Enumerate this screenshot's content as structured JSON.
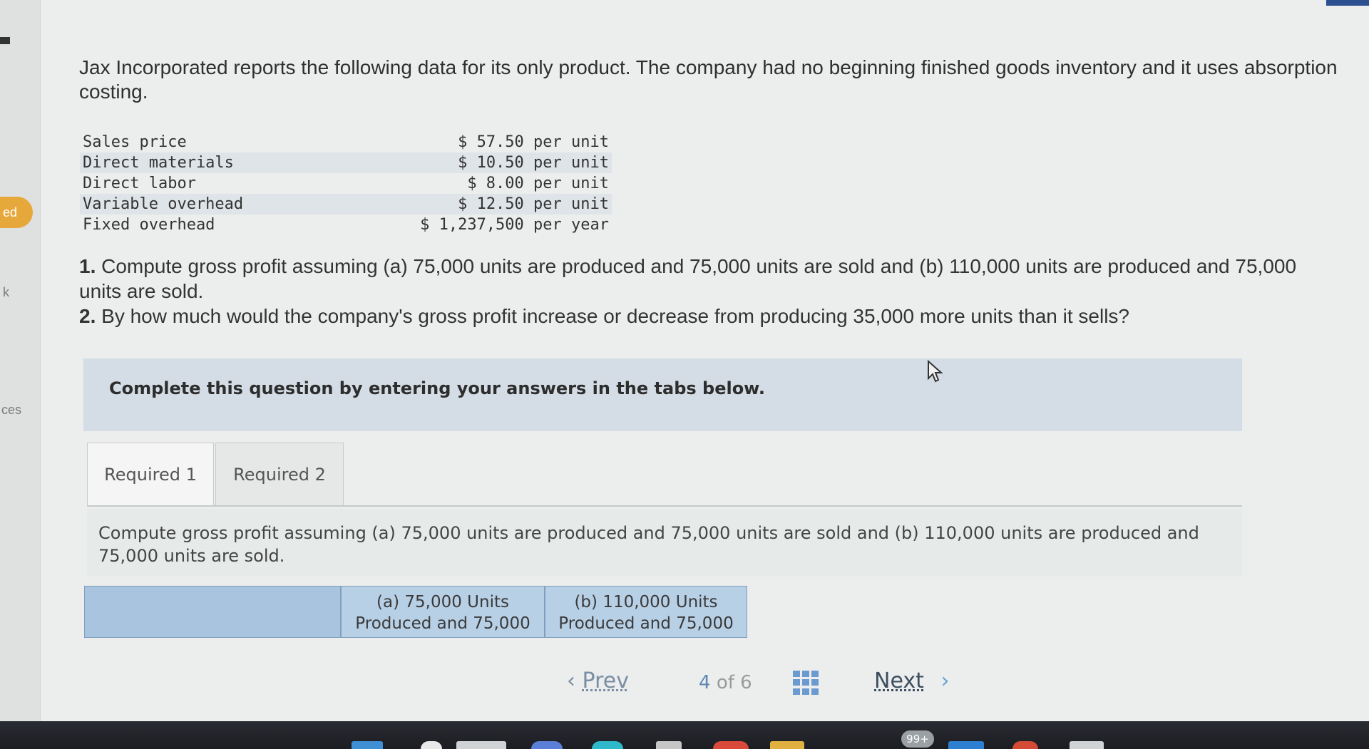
{
  "left_sidebar": {
    "items": [
      "ed",
      "k",
      "ces"
    ]
  },
  "problem": {
    "intro": "Jax Incorporated reports the following data for its only product. The company had no beginning finished goods inventory and it uses absorption costing.",
    "data": [
      {
        "label": "Sales price",
        "value": "$ 57.50 per unit"
      },
      {
        "label": "Direct materials",
        "value": "$ 10.50 per unit"
      },
      {
        "label": "Direct labor",
        "value": "$ 8.00 per unit"
      },
      {
        "label": "Variable overhead",
        "value": "$ 12.50 per unit"
      },
      {
        "label": "Fixed overhead",
        "value": "$ 1,237,500 per year"
      }
    ],
    "q1_num": "1.",
    "q1_text": "Compute gross profit assuming (a) 75,000 units are produced and 75,000 units are sold and (b) 110,000 units are produced and 75,000 units are sold.",
    "q2_num": "2.",
    "q2_text": "By how much would the company's gross profit increase or decrease from producing 35,000 more units than it sells?"
  },
  "instruction": "Complete this question by entering your answers in the tabs below.",
  "tabs": [
    {
      "label": "Required 1",
      "active": true
    },
    {
      "label": "Required 2",
      "active": false
    }
  ],
  "required1": {
    "text": "Compute gross profit assuming (a) 75,000 units are produced and 75,000 units are sold and (b) 110,000 units are produced and 75,000 units are sold.",
    "columns": [
      {
        "line1": "(a) 75,000 Units",
        "line2": "Produced and 75,000"
      },
      {
        "line1": "(b) 110,000 Units",
        "line2": "Produced and 75,000"
      }
    ]
  },
  "navigation": {
    "prev_label": "Prev",
    "current_page": "4",
    "of_label": "of",
    "total_pages": "6",
    "next_label": "Next"
  },
  "taskbar": {
    "badge": "99+"
  },
  "colors": {
    "accent_tab": "#e6a83a",
    "table_header": "#b8d0e6",
    "instruction_bg": "#d4dde5"
  }
}
